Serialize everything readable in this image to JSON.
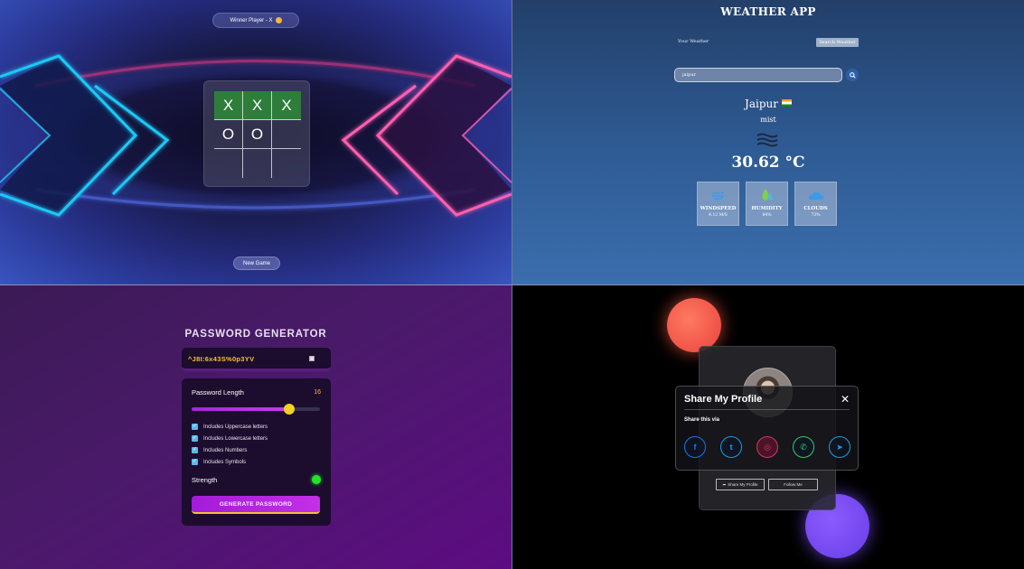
{
  "tictactoe": {
    "winner_text": "Winner Player - X",
    "board": [
      "X",
      "X",
      "X",
      "O",
      "O",
      "",
      "",
      "",
      ""
    ],
    "winning_cells": [
      0,
      1,
      2
    ],
    "new_game_label": "New Game",
    "colors": {
      "win": "#2e7d3a",
      "neon_blue": "#1fc8f5",
      "neon_pink": "#ff5fb0"
    }
  },
  "weather": {
    "title": "WEATHER APP",
    "tab_your": "Your Weather",
    "tab_search": "Search Weather",
    "search_value": "jaipur",
    "city": "Jaipur",
    "description": "mist",
    "temperature": "30.62 °C",
    "cards": [
      {
        "icon": "wind-icon",
        "label": "WINDSPEED",
        "value": "4.12 M/S"
      },
      {
        "icon": "humidity-icon",
        "label": "HUMIDITY",
        "value": "84%"
      },
      {
        "icon": "cloud-icon",
        "label": "CLOUDS",
        "value": "73%"
      }
    ]
  },
  "password": {
    "title": "PASSWORD GENERATOR",
    "generated": "^J8I:6x43S%0p3YV",
    "length_label": "Password Length",
    "length_value": "16",
    "length_fraction": 0.76,
    "options": [
      {
        "label": "Includes Uppercase letters",
        "checked": true
      },
      {
        "label": "Includes Lowercase letters",
        "checked": true
      },
      {
        "label": "Includes Numbers",
        "checked": true
      },
      {
        "label": "Includes Symbols",
        "checked": true
      }
    ],
    "strength_label": "Strength",
    "strength_color": "#22e22a",
    "generate_label": "GENERATE PASSWORD"
  },
  "share": {
    "modal_title": "Share My Profile",
    "close_symbol": "✕",
    "subtitle": "Share this via",
    "platforms": [
      {
        "name": "facebook-icon",
        "glyph": "f",
        "color": "#1877f2"
      },
      {
        "name": "twitter-icon",
        "glyph": "t",
        "color": "#1d9bf0"
      },
      {
        "name": "instagram-icon",
        "glyph": "◎",
        "color": "#e1306c"
      },
      {
        "name": "whatsapp-icon",
        "glyph": "✆",
        "color": "#25d366"
      },
      {
        "name": "telegram-icon",
        "glyph": "➤",
        "color": "#229ed9"
      }
    ],
    "share_button_label": "Share My Profile",
    "follow_button_label": "Follow Me"
  }
}
